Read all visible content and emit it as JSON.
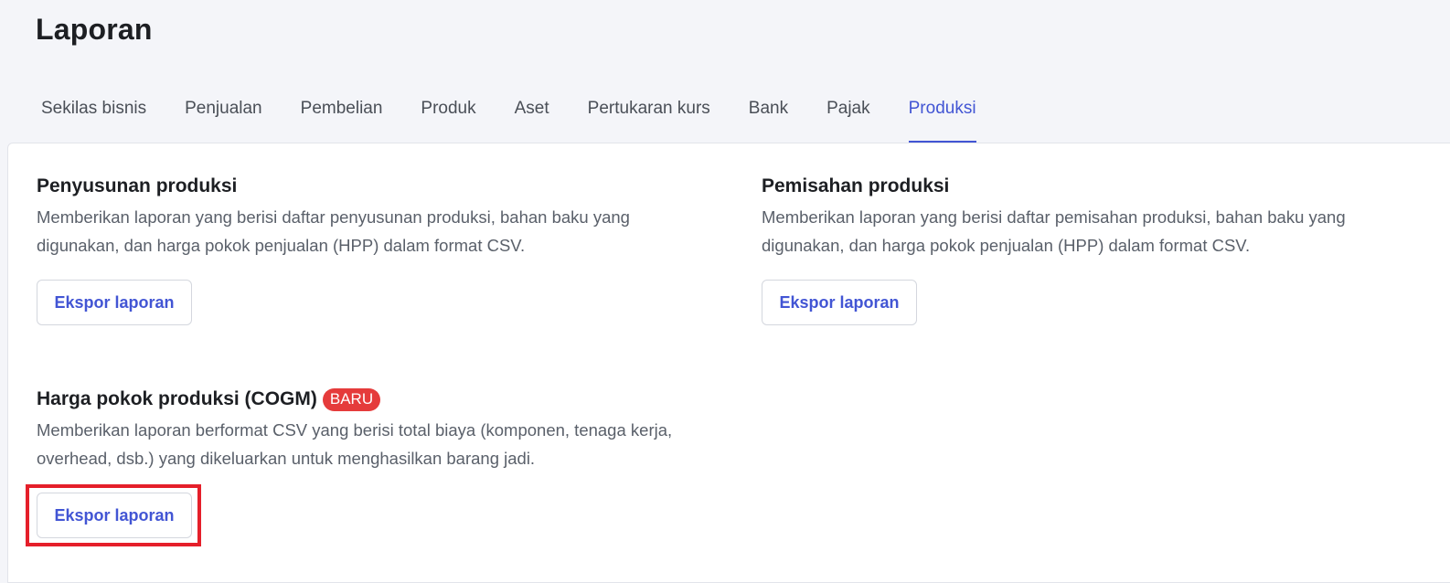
{
  "page": {
    "title": "Laporan"
  },
  "tabs": [
    {
      "label": "Sekilas bisnis",
      "active": false
    },
    {
      "label": "Penjualan",
      "active": false
    },
    {
      "label": "Pembelian",
      "active": false
    },
    {
      "label": "Produk",
      "active": false
    },
    {
      "label": "Aset",
      "active": false
    },
    {
      "label": "Pertukaran kurs",
      "active": false
    },
    {
      "label": "Bank",
      "active": false
    },
    {
      "label": "Pajak",
      "active": false
    },
    {
      "label": "Produksi",
      "active": true
    }
  ],
  "sections": {
    "assembly": {
      "title": "Penyusunan produksi",
      "description": "Memberikan laporan yang berisi daftar penyusunan produksi, bahan baku yang digunakan, dan harga pokok penjualan (HPP) dalam format CSV.",
      "button_label": "Ekspor laporan"
    },
    "disassembly": {
      "title": "Pemisahan produksi",
      "description": "Memberikan laporan yang berisi daftar pemisahan produksi, bahan baku yang digunakan, dan harga pokok penjualan (HPP) dalam format CSV.",
      "button_label": "Ekspor laporan"
    },
    "cogm": {
      "title": "Harga pokok produksi (COGM)",
      "badge": "BARU",
      "description": "Memberikan laporan berformat CSV yang berisi total biaya (komponen, tenaga kerja, overhead, dsb.) yang dikeluarkan untuk menghasilkan barang jadi.",
      "button_label": "Ekspor laporan"
    }
  },
  "colors": {
    "accent": "#4255d4",
    "badge": "#e53b3b",
    "highlight": "#e51f2a",
    "background": "#f4f5f9"
  }
}
